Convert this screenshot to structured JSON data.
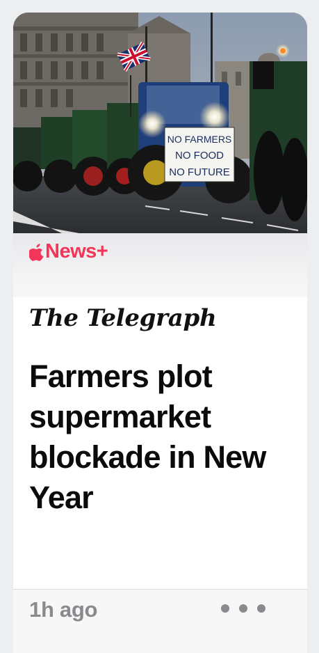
{
  "hero": {
    "sign_lines": [
      "NO FARMERS",
      "NO FOOD",
      "NO FUTURE"
    ],
    "icon": "news-photo-tractors"
  },
  "news_plus": {
    "label": "News+",
    "icon": "apple-icon",
    "color": "#f2365a"
  },
  "article": {
    "publisher": "The Telegraph",
    "headline": "Farmers plot supermarket blockade in New Year",
    "timestamp": "1h ago"
  },
  "actions": {
    "more_icon": "ellipsis-icon"
  }
}
